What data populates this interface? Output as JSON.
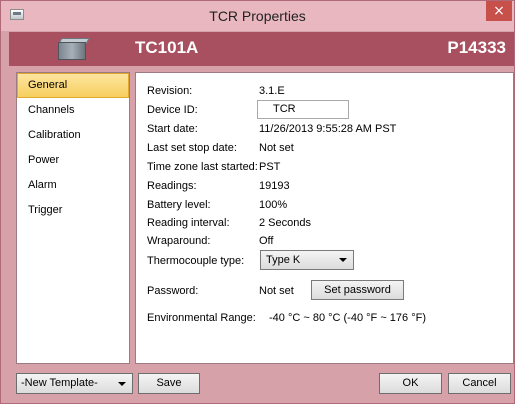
{
  "window": {
    "title": "TCR Properties",
    "close_glyph": "×"
  },
  "header": {
    "model": "TC101A",
    "serial": "P14333"
  },
  "nav": {
    "items": [
      {
        "label": "General",
        "selected": true
      },
      {
        "label": "Channels"
      },
      {
        "label": "Calibration"
      },
      {
        "label": "Power"
      },
      {
        "label": "Alarm"
      },
      {
        "label": "Trigger"
      }
    ]
  },
  "general": {
    "revision": {
      "label": "Revision:",
      "value": "3.1.E"
    },
    "device_id": {
      "label": "Device ID:",
      "value": "TCR"
    },
    "start_date": {
      "label": "Start date:",
      "value": "11/26/2013 9:55:28 AM PST"
    },
    "last_stop": {
      "label": "Last set stop date:",
      "value": "Not set"
    },
    "timezone": {
      "label": "Time zone last started:",
      "value": "PST"
    },
    "readings": {
      "label": "Readings:",
      "value": "19193"
    },
    "battery": {
      "label": "Battery level:",
      "value": "100%"
    },
    "interval": {
      "label": "Reading interval:",
      "value": "2 Seconds"
    },
    "wraparound": {
      "label": "Wraparound:",
      "value": "Off"
    },
    "thermocouple": {
      "label": "Thermocouple type:",
      "value": "Type K"
    },
    "password": {
      "label": "Password:",
      "value": "Not set",
      "button": "Set password"
    },
    "env_range": {
      "label": "Environmental Range:",
      "value": "-40 °C ~ 80 °C (-40 °F ~ 176 °F)"
    }
  },
  "footer": {
    "template": "-New Template-",
    "save": "Save",
    "ok": "OK",
    "cancel": "Cancel"
  }
}
